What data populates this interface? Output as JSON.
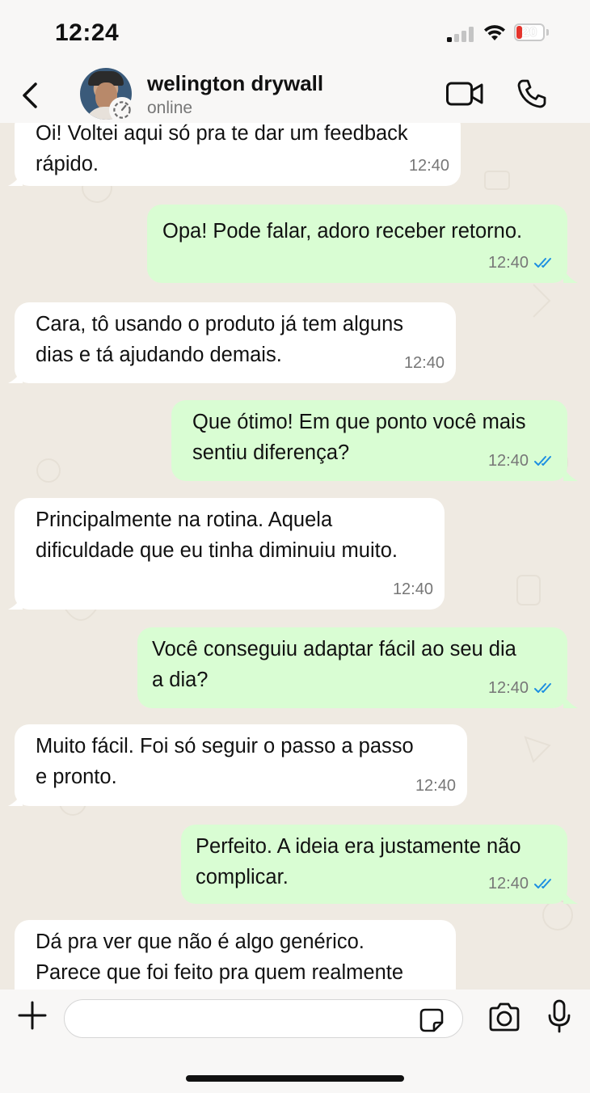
{
  "status_bar": {
    "time": "12:24",
    "battery_level": "20",
    "battery_color": "#e5342c"
  },
  "header": {
    "contact_name": "welington drywall",
    "contact_status": "online",
    "icons": [
      "back-arrow-icon",
      "avatar",
      "status-ring-icon",
      "video-camera-icon",
      "phone-icon"
    ]
  },
  "messages": [
    {
      "direction": "in",
      "text": "Oi! Voltei aqui só pra te dar um feedback\nrápido.",
      "time": "12:40",
      "ticks": false
    },
    {
      "direction": "out",
      "text": "Opa! Pode falar, adoro receber retorno.",
      "time": "12:40",
      "ticks": true
    },
    {
      "direction": "in",
      "text": "Cara, tô usando o produto já tem alguns\ndias e tá ajudando demais.",
      "time": "12:40",
      "ticks": false
    },
    {
      "direction": "out",
      "text": "Que ótimo! Em que ponto você mais\nsentiu diferença?",
      "time": "12:40",
      "ticks": true
    },
    {
      "direction": "in",
      "text": "Principalmente na rotina. Aquela\ndificuldade que eu tinha diminuiu muito.",
      "time": "12:40",
      "ticks": false
    },
    {
      "direction": "out",
      "text": "Você conseguiu adaptar fácil ao seu dia\na dia?",
      "time": "12:40",
      "ticks": true
    },
    {
      "direction": "in",
      "text": "Muito fácil. Foi só seguir o passo a passo\ne pronto.",
      "time": "12:40",
      "ticks": false
    },
    {
      "direction": "out",
      "text": "Perfeito. A ideia era justamente não\ncomplicar.",
      "time": "12:40",
      "ticks": true
    },
    {
      "direction": "in",
      "text": "Dá pra ver que não é algo genérico.\nParece que foi feito pra quem realmente",
      "time": "",
      "ticks": false
    }
  ],
  "colors": {
    "incoming_bubble": "#ffffff",
    "outgoing_bubble": "#d9fdd3",
    "read_ticks": "#1d8fe1",
    "chat_background": "#efeae2"
  },
  "input_bar": {
    "placeholder": "",
    "icons": [
      "plus-icon",
      "sticker-icon",
      "camera-icon",
      "microphone-icon"
    ]
  }
}
